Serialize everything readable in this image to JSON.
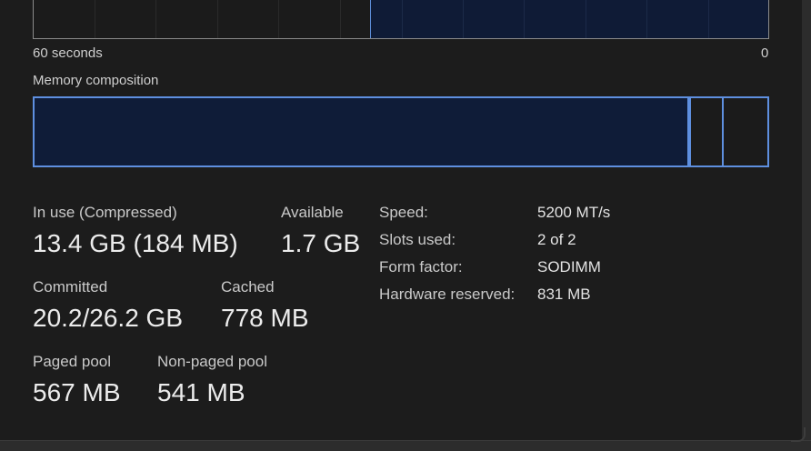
{
  "graph": {
    "time_span_label": "60 seconds",
    "end_label": "0"
  },
  "composition": {
    "title": "Memory composition"
  },
  "stats": {
    "in_use": {
      "label": "In use (Compressed)",
      "value": "13.4 GB (184 MB)"
    },
    "available": {
      "label": "Available",
      "value": "1.7 GB"
    },
    "committed": {
      "label": "Committed",
      "value": "20.2/26.2 GB"
    },
    "cached": {
      "label": "Cached",
      "value": "778 MB"
    },
    "paged_pool": {
      "label": "Paged pool",
      "value": "567 MB"
    },
    "non_paged_pool": {
      "label": "Non-paged pool",
      "value": "541 MB"
    }
  },
  "specs": [
    {
      "label": "Speed:",
      "value": "5200 MT/s"
    },
    {
      "label": "Slots used:",
      "value": "2 of 2"
    },
    {
      "label": "Form factor:",
      "value": "SODIMM"
    },
    {
      "label": "Hardware reserved:",
      "value": "831 MB"
    }
  ],
  "colors": {
    "accent": "#5e8fdf",
    "fill": "#0f1c38",
    "background": "#1c1c1c"
  }
}
